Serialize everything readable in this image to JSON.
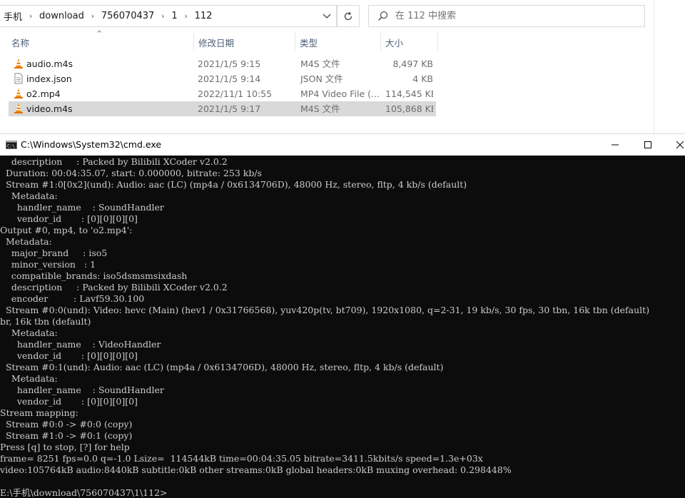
{
  "explorer": {
    "breadcrumb": [
      "手机",
      "download",
      "756070437",
      "1",
      "112"
    ],
    "search_placeholder": "在 112 中搜索",
    "columns": {
      "name": "名称",
      "date": "修改日期",
      "type": "类型",
      "size": "大小"
    },
    "sort_indicator": "^",
    "files": [
      {
        "icon": "vlc-cone-icon",
        "name": "audio.m4s",
        "date": "2021/1/5 9:15",
        "type": "M4S 文件",
        "size": "8,497 KB"
      },
      {
        "icon": "text-file-icon",
        "name": "index.json",
        "date": "2021/1/5 9:14",
        "type": "JSON 文件",
        "size": "4 KB"
      },
      {
        "icon": "vlc-cone-icon",
        "name": "o2.mp4",
        "date": "2022/11/1 10:55",
        "type": "MP4 Video File (...",
        "size": "114,545 KB"
      },
      {
        "icon": "vlc-cone-icon",
        "name": "video.m4s",
        "date": "2021/1/5 9:17",
        "type": "M4S 文件",
        "size": "105,868 KB",
        "selected": true
      }
    ]
  },
  "cmd": {
    "title": "C:\\Windows\\System32\\cmd.exe",
    "lines": [
      "    description     : Packed by Bilibili XCoder v2.0.2",
      "  Duration: 00:04:35.07, start: 0.000000, bitrate: 253 kb/s",
      "  Stream #1:0[0x2](und): Audio: aac (LC) (mp4a / 0x6134706D), 48000 Hz, stereo, fltp, 4 kb/s (default)",
      "    Metadata:",
      "      handler_name    : SoundHandler",
      "      vendor_id       : [0][0][0][0]",
      "Output #0, mp4, to 'o2.mp4':",
      "  Metadata:",
      "    major_brand     : iso5",
      "    minor_version   : 1",
      "    compatible_brands: iso5dsmsmsixdash",
      "    description     : Packed by Bilibili XCoder v2.0.2",
      "    encoder         : Lavf59.30.100",
      "  Stream #0:0(und): Video: hevc (Main) (hev1 / 0x31766568), yuv420p(tv, bt709), 1920x1080, q=2-31, 19 kb/s, 30 fps, 30 tbn, 16k tbn (default)",
      "br, 16k tbn (default)",
      "    Metadata:",
      "      handler_name    : VideoHandler",
      "      vendor_id       : [0][0][0][0]",
      "  Stream #0:1(und): Audio: aac (LC) (mp4a / 0x6134706D), 48000 Hz, stereo, fltp, 4 kb/s (default)",
      "    Metadata:",
      "      handler_name    : SoundHandler",
      "      vendor_id       : [0][0][0][0]",
      "Stream mapping:",
      "  Stream #0:0 -> #0:0 (copy)",
      "  Stream #1:0 -> #0:1 (copy)",
      "Press [q] to stop, [?] for help",
      "frame= 8251 fps=0.0 q=-1.0 Lsize=  114544kB time=00:04:35.05 bitrate=3411.5kbits/s speed=1.3e+03x",
      "video:105764kB audio:8440kB subtitle:0kB other streams:0kB global headers:0kB muxing overhead: 0.298448%",
      "",
      "E:\\手机\\download\\756070437\\1\\112>"
    ]
  }
}
